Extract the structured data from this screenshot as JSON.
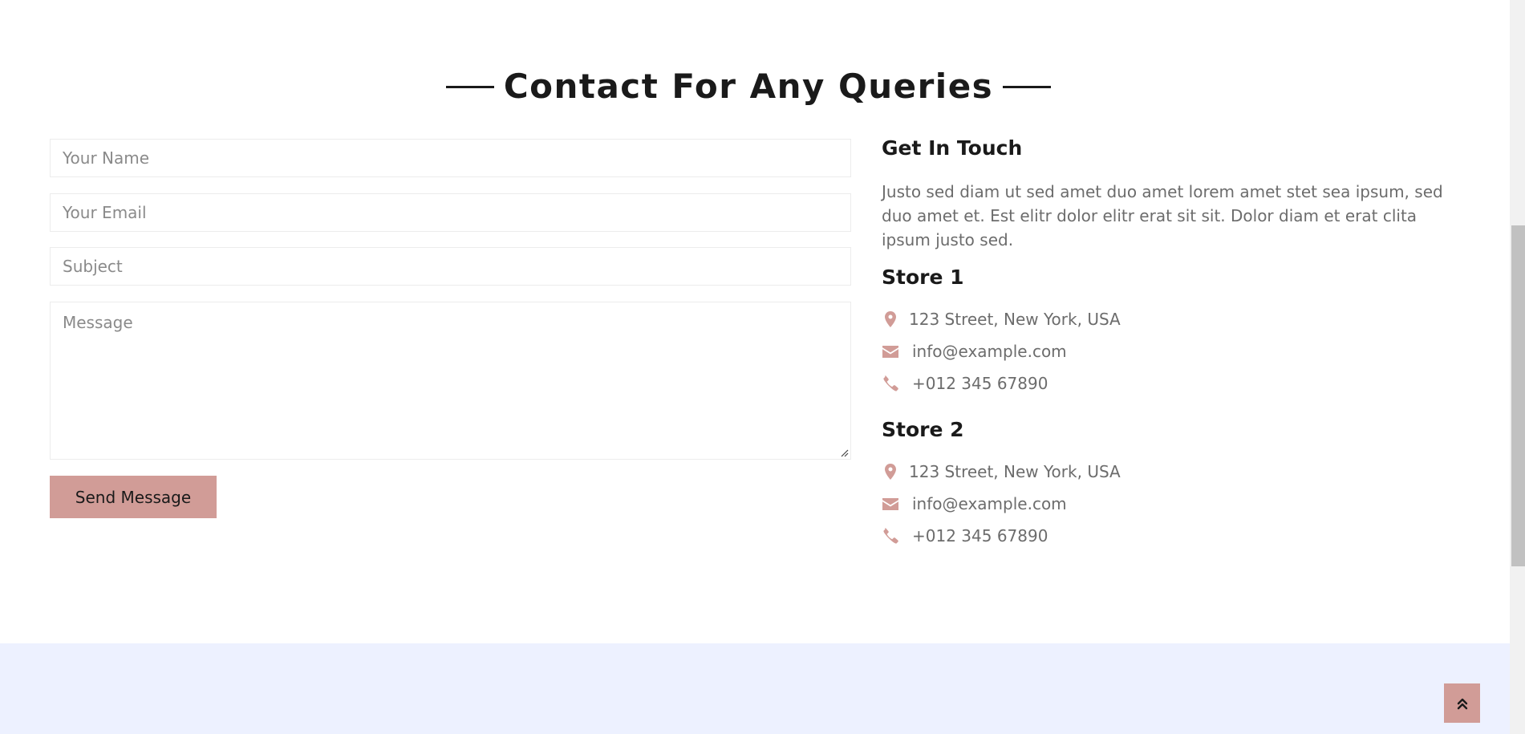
{
  "heading": "Contact For Any Queries",
  "form": {
    "name_placeholder": "Your Name",
    "email_placeholder": "Your Email",
    "subject_placeholder": "Subject",
    "message_placeholder": "Message",
    "send_label": "Send Message"
  },
  "contact": {
    "title": "Get In Touch",
    "description": "Justo sed diam ut sed amet duo amet lorem amet stet sea ipsum, sed duo amet et. Est elitr dolor elitr erat sit sit. Dolor diam et erat clita ipsum justo sed.",
    "stores": [
      {
        "name": "Store 1",
        "address": "123 Street, New York, USA",
        "email": "info@example.com",
        "phone": "+012 345 67890"
      },
      {
        "name": "Store 2",
        "address": "123 Street, New York, USA",
        "email": "info@example.com",
        "phone": "+012 345 67890"
      }
    ]
  },
  "icons": {
    "address": "map-marker-icon",
    "email": "envelope-icon",
    "phone": "phone-icon",
    "back_to_top": "double-chevron-up-icon"
  },
  "colors": {
    "accent": "#d19c97",
    "heading": "#1a1a1a",
    "body_text": "#6c6c6c",
    "footer_bg": "#edf1ff"
  }
}
